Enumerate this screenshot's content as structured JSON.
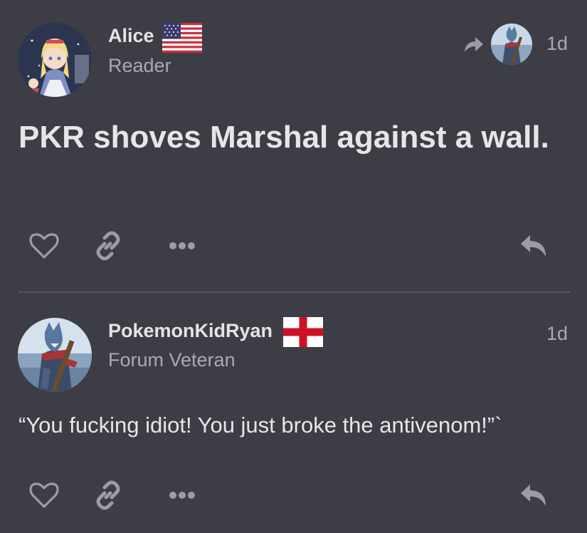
{
  "posts": [
    {
      "username": "Alice",
      "user_title": "Reader",
      "flag_icon": "us-flag-icon",
      "timestamp": "1d",
      "body": "PKR shoves Marshal against a wall.",
      "reply_to_icon": "reply-to-arrow-icon",
      "actions": [
        "heart-icon",
        "link-icon",
        "more-icon",
        "reply-icon"
      ]
    },
    {
      "username": "PokemonKidRyan",
      "user_title": "Forum Veteran",
      "flag_icon": "england-flag-icon",
      "timestamp": "1d",
      "body": "“You fucking idiot! You just broke the antivenom!”`",
      "actions": [
        "heart-icon",
        "link-icon",
        "more-icon",
        "reply-icon"
      ]
    }
  ],
  "colors": {
    "background": "#3d3e45",
    "text": "#e4e4e6",
    "muted": "#a9aab0",
    "icon": "#9c9da3",
    "divider": "#56575e"
  }
}
